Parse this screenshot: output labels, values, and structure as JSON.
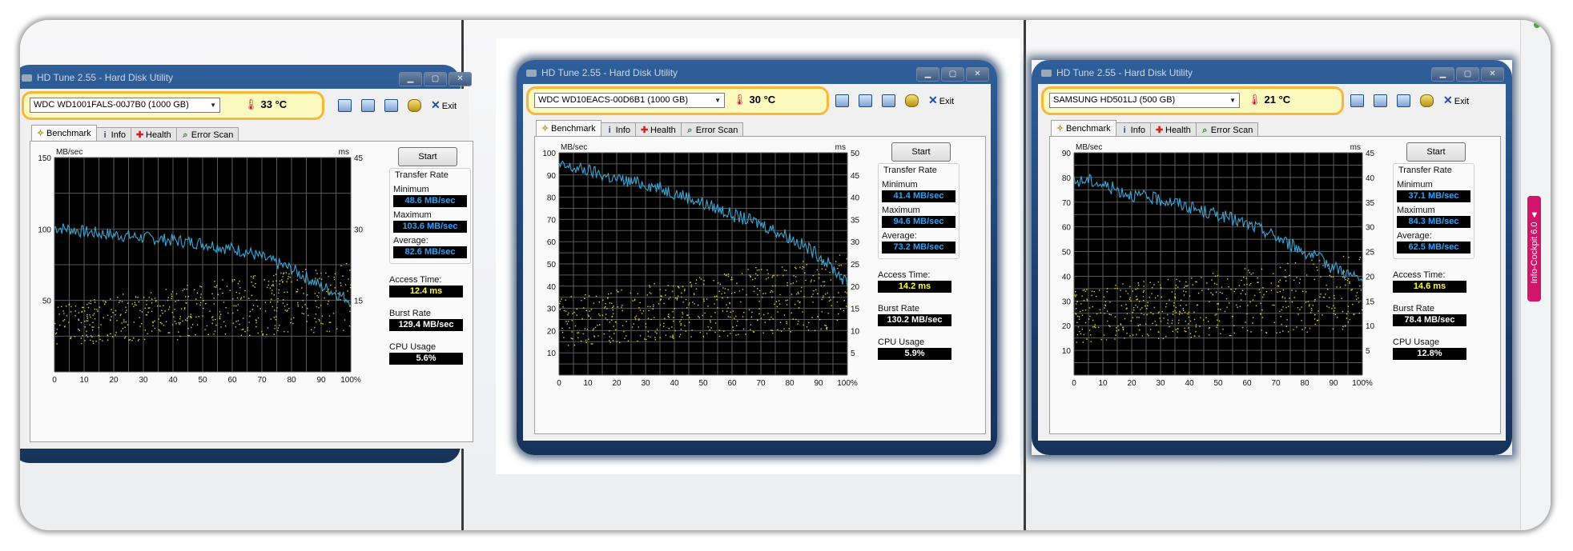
{
  "panels": [
    {
      "title": "HD Tune 2.55 - Hard Disk Utility",
      "drive": "WDC WD1001FALS-00J7B0 (1000 GB)",
      "temperature": "33 °C",
      "exit_label": "Exit",
      "tabs": [
        "Benchmark",
        "Info",
        "Health",
        "Error Scan"
      ],
      "start_label": "Start",
      "transfer_rate_label": "Transfer Rate",
      "minimum_label": "Minimum",
      "minimum": "48.6 MB/sec",
      "maximum_label": "Maximum",
      "maximum": "103.6 MB/sec",
      "average_label": "Average:",
      "average": "82.6 MB/sec",
      "access_label": "Access Time:",
      "access": "12.4 ms",
      "burst_label": "Burst Rate",
      "burst": "129.4 MB/sec",
      "cpu_label": "CPU Usage",
      "cpu": "5.6%"
    },
    {
      "title": "HD Tune 2.55 - Hard Disk Utility",
      "drive": "WDC WD10EACS-00D6B1 (1000 GB)",
      "temperature": "30 °C",
      "exit_label": "Exit",
      "tabs": [
        "Benchmark",
        "Info",
        "Health",
        "Error Scan"
      ],
      "start_label": "Start",
      "transfer_rate_label": "Transfer Rate",
      "minimum_label": "Minimum",
      "minimum": "41.4 MB/sec",
      "maximum_label": "Maximum",
      "maximum": "94.6 MB/sec",
      "average_label": "Average:",
      "average": "73.2 MB/sec",
      "access_label": "Access Time:",
      "access": "14.2 ms",
      "burst_label": "Burst Rate",
      "burst": "130.2 MB/sec",
      "cpu_label": "CPU Usage",
      "cpu": "5.9%"
    },
    {
      "title": "HD Tune 2.55 - Hard Disk Utility",
      "drive": "SAMSUNG HD501LJ (500 GB)",
      "temperature": "21 °C",
      "exit_label": "Exit",
      "tabs": [
        "Benchmark",
        "Info",
        "Health",
        "Error Scan"
      ],
      "start_label": "Start",
      "transfer_rate_label": "Transfer Rate",
      "minimum_label": "Minimum",
      "minimum": "37.1 MB/sec",
      "maximum_label": "Maximum",
      "maximum": "84.3 MB/sec",
      "average_label": "Average:",
      "average": "62.5 MB/sec",
      "access_label": "Access Time:",
      "access": "14.6 ms",
      "burst_label": "Burst Rate",
      "burst": "78.4 MB/sec",
      "cpu_label": "CPU Usage",
      "cpu": "12.8%"
    }
  ],
  "sidebar_tab": "Info-Cockpit 6.0 ◄",
  "colors": {
    "highlight_border": "#f7b83a",
    "highlight_fill": "#fbf9be",
    "transfer_line": "#3ba7d6",
    "access_dots": "#d8d82a",
    "sidebar_tab": "#d0156a"
  },
  "icons": [
    "thermometer-icon",
    "copy-icon",
    "paste-icon",
    "save-icon",
    "options-icon",
    "exit-icon",
    "benchmark-icon",
    "info-icon",
    "health-icon",
    "error-scan-icon"
  ],
  "chart_data": [
    {
      "type": "line",
      "xlabel": "",
      "ylabel": "MB/sec",
      "y2label": "ms",
      "x_ticks": [
        "0",
        "10",
        "20",
        "30",
        "40",
        "50",
        "60",
        "70",
        "80",
        "90",
        "100%"
      ],
      "y_ticks": [
        "150",
        "100",
        "50"
      ],
      "y2_ticks": [
        "45",
        "30",
        "15"
      ],
      "xlim": [
        0,
        100
      ],
      "ylim": [
        0,
        150
      ],
      "y2lim": [
        0,
        45
      ],
      "series": [
        {
          "x": [
            0,
            5,
            10,
            15,
            20,
            25,
            30,
            35,
            40,
            45,
            50,
            55,
            60,
            65,
            70,
            75,
            80,
            85,
            90,
            95,
            100
          ],
          "y": [
            101,
            100,
            98,
            97,
            96,
            95,
            94,
            93,
            92,
            91,
            90,
            88,
            86,
            84,
            80,
            76,
            72,
            66,
            60,
            55,
            50
          ]
        }
      ],
      "access_trend_ms": {
        "start": 10,
        "end": 16
      }
    },
    {
      "type": "line",
      "xlabel": "",
      "ylabel": "MB/sec",
      "y2label": "ms",
      "x_ticks": [
        "0",
        "10",
        "20",
        "30",
        "40",
        "50",
        "60",
        "70",
        "80",
        "90",
        "100%"
      ],
      "y_ticks": [
        "100",
        "90",
        "80",
        "70",
        "60",
        "50",
        "40",
        "30",
        "20",
        "10"
      ],
      "y2_ticks": [
        "50",
        "45",
        "40",
        "35",
        "30",
        "25",
        "20",
        "15",
        "10",
        "5"
      ],
      "xlim": [
        0,
        100
      ],
      "ylim": [
        0,
        100
      ],
      "y2lim": [
        0,
        50
      ],
      "series": [
        {
          "x": [
            0,
            5,
            10,
            15,
            20,
            25,
            30,
            35,
            40,
            45,
            50,
            55,
            60,
            65,
            70,
            75,
            80,
            85,
            90,
            95,
            100
          ],
          "y": [
            94,
            93,
            92,
            90,
            88,
            87,
            86,
            84,
            82,
            80,
            77,
            75,
            72,
            70,
            68,
            65,
            62,
            58,
            54,
            48,
            41
          ]
        }
      ],
      "access_trend_ms": {
        "start": 12,
        "end": 19
      }
    },
    {
      "type": "line",
      "xlabel": "",
      "ylabel": "MB/sec",
      "y2label": "ms",
      "x_ticks": [
        "0",
        "10",
        "20",
        "30",
        "40",
        "50",
        "60",
        "70",
        "80",
        "90",
        "100%"
      ],
      "y_ticks": [
        "90",
        "80",
        "70",
        "60",
        "50",
        "40",
        "30",
        "20",
        "10"
      ],
      "y2_ticks": [
        "45",
        "40",
        "35",
        "30",
        "25",
        "20",
        "15",
        "10",
        "5"
      ],
      "xlim": [
        0,
        100
      ],
      "ylim": [
        0,
        90
      ],
      "y2lim": [
        0,
        45
      ],
      "series": [
        {
          "x": [
            0,
            5,
            10,
            15,
            20,
            25,
            30,
            35,
            40,
            45,
            50,
            55,
            60,
            65,
            70,
            75,
            80,
            85,
            90,
            95,
            100
          ],
          "y": [
            78,
            79,
            77,
            75,
            73,
            72,
            71,
            70,
            68,
            66,
            65,
            63,
            61,
            59,
            56,
            53,
            50,
            47,
            44,
            41,
            38
          ]
        }
      ],
      "access_trend_ms": {
        "start": 12,
        "end": 17
      }
    }
  ]
}
